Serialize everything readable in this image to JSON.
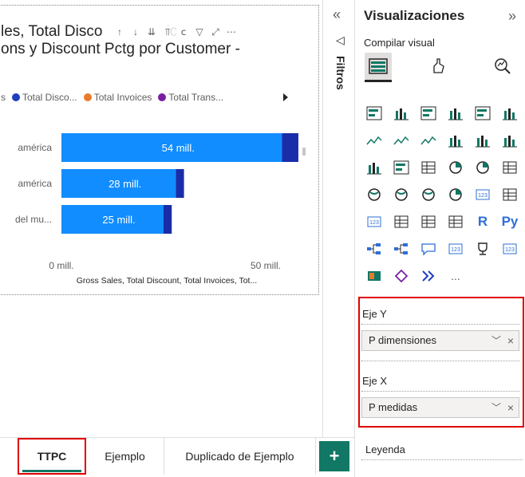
{
  "chart": {
    "title_line1": "les, Total Disco",
    "title_line1_tail": "ic",
    "title_line2": "ons y Discount Pctg por Customer -",
    "legend_items": [
      {
        "label": "s",
        "color": ""
      },
      {
        "label": "Total Disco...",
        "color": "#1f3fbf"
      },
      {
        "label": "Total Invoices",
        "color": "#e97c2b"
      },
      {
        "label": "Total Trans...",
        "color": "#7a1fa2"
      }
    ],
    "x_axis_title": "Gross Sales, Total Discount, Total Invoices, Tot...",
    "x_ticks": [
      "0 mill.",
      "50 mill."
    ]
  },
  "chart_data": {
    "type": "bar",
    "orientation": "horizontal",
    "categories": [
      "américa",
      "américa",
      "del mu..."
    ],
    "series": [
      {
        "values": [
          54,
          28,
          25
        ],
        "color": "#118dff"
      },
      {
        "values": [
          4,
          2,
          2
        ],
        "color": "#1a2da8"
      }
    ],
    "data_labels": [
      "54 mill.",
      "28 mill.",
      "25 mill."
    ],
    "xlim": [
      0,
      60
    ],
    "x_ticks": [
      0,
      50
    ],
    "x_tick_labels": [
      "0 mill.",
      "50 mill."
    ],
    "xlabel": "Gross Sales, Total Discount, Total Invoices, Tot...",
    "legend": "top"
  },
  "filters": {
    "label": "Filtros"
  },
  "viz_pane": {
    "title": "Visualizaciones",
    "compile_label": "Compilar visual",
    "r_label": "R",
    "py_label": "Py",
    "more_label": "...",
    "wells": [
      {
        "label": "Eje Y",
        "field": "P dimensiones"
      },
      {
        "label": "Eje X",
        "field": "P medidas"
      }
    ],
    "legend_well": "Leyenda"
  },
  "pages": {
    "tabs": [
      "TTPC",
      "Ejemplo",
      "Duplicado de Ejemplo"
    ],
    "add": "+"
  },
  "colors": {
    "accent": "#117865",
    "highlight": "#e00000",
    "bar_main": "#118dff",
    "bar_dark": "#1a2da8"
  }
}
